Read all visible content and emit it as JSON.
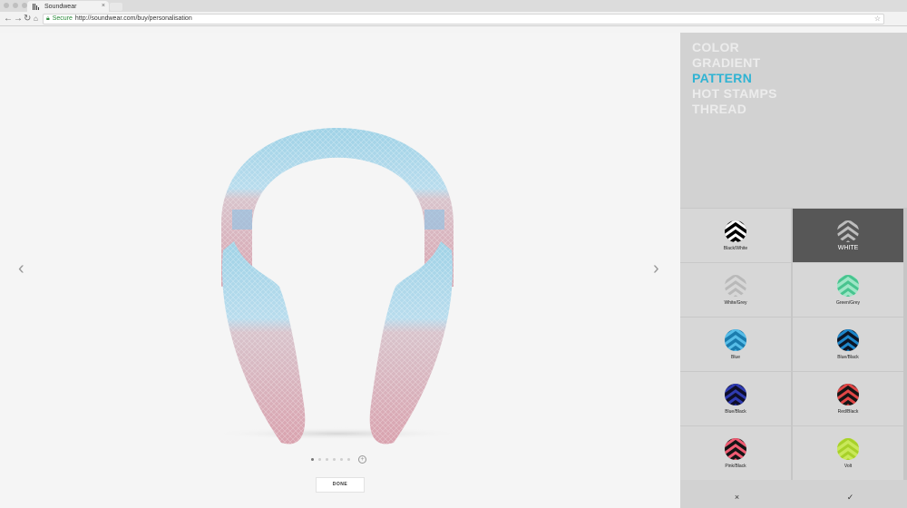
{
  "browser": {
    "tab_title": "Soundwear",
    "tab_close": "×",
    "secure_label": "Secure",
    "url": "http://soundwear.com/buy/personalisation",
    "star": "☆"
  },
  "product": {
    "pager_count": 6,
    "pager_active": 0,
    "done_label": "DONE",
    "prev_arrow": "‹",
    "next_arrow": "›"
  },
  "menu": [
    "COLOR",
    "GRADIENT",
    "PATTERN",
    "HOT STAMPS",
    "THREAD"
  ],
  "menu_active": "PATTERN",
  "patterns": [
    {
      "label": "Black/White",
      "bg": "#000000",
      "fg": "#ffffff",
      "selected": false
    },
    {
      "label": "WHITE",
      "bg": "#575757",
      "fg": "#bdbdbd",
      "selected": true
    },
    {
      "label": "White/Grey",
      "bg": "#d7d7d7",
      "fg": "#b9b9b9",
      "selected": false
    },
    {
      "label": "Green/Grey",
      "bg": "#9ee6c6",
      "fg": "#48c48f",
      "selected": false
    },
    {
      "label": "Blue",
      "bg": "#1b7cae",
      "fg": "#57bde8",
      "selected": false
    },
    {
      "label": "Blue/Black",
      "bg": "#0c1525",
      "fg": "#1e86c9",
      "selected": false
    },
    {
      "label": "Blue/Black",
      "bg": "#0e0e2a",
      "fg": "#2f3bb0",
      "selected": false
    },
    {
      "label": "Red/Black",
      "bg": "#151515",
      "fg": "#e04646",
      "selected": false
    },
    {
      "label": "Pink/Black",
      "bg": "#141414",
      "fg": "#f05c73",
      "selected": false
    },
    {
      "label": "Volt",
      "bg": "#c9e85a",
      "fg": "#a8d12a",
      "selected": false
    }
  ],
  "actions": {
    "cancel": "×",
    "confirm": "✓"
  }
}
